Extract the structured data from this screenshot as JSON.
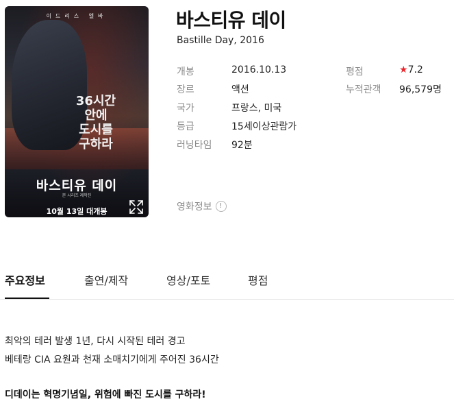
{
  "poster": {
    "top_names": "이드리스 엘바",
    "tagline": "36시간\n안에\n도시를\n구하라",
    "title": "바스티유 데이",
    "subtitle": "본 시리즈 제작진",
    "release": "10월 13일 대개봉"
  },
  "movie": {
    "title": "바스티유 데이",
    "original_title": "Bastille Day, 2016"
  },
  "meta_left": [
    {
      "label": "개봉",
      "value": "2016.10.13"
    },
    {
      "label": "장르",
      "value": "액션"
    },
    {
      "label": "국가",
      "value": "프랑스, 미국"
    },
    {
      "label": "등급",
      "value": "15세이상관람가"
    },
    {
      "label": "러닝타임",
      "value": "92분"
    }
  ],
  "meta_right": {
    "rating_label": "평점",
    "rating_star": "★",
    "rating_value": "7.2",
    "audience_label": "누적관객",
    "audience_value": "96,579명"
  },
  "info_link": {
    "label": "영화정보",
    "icon": "!"
  },
  "tabs": [
    {
      "label": "주요정보",
      "active": true
    },
    {
      "label": "출연/제작",
      "active": false
    },
    {
      "label": "영상/포토",
      "active": false
    },
    {
      "label": "평점",
      "active": false
    }
  ],
  "synopsis": {
    "line1": "최악의 테러 발생 1년, 다시 시작된 테러 경고",
    "line2": "베테랑 CIA 요원과 천재 소매치기에게 주어진 36시간",
    "headline": "디데이는 혁명기념일, 위험에 빠진 도시를 구하라!"
  },
  "colors": {
    "star": "#e8262c",
    "label": "#8a8a8a",
    "text": "#222222"
  }
}
